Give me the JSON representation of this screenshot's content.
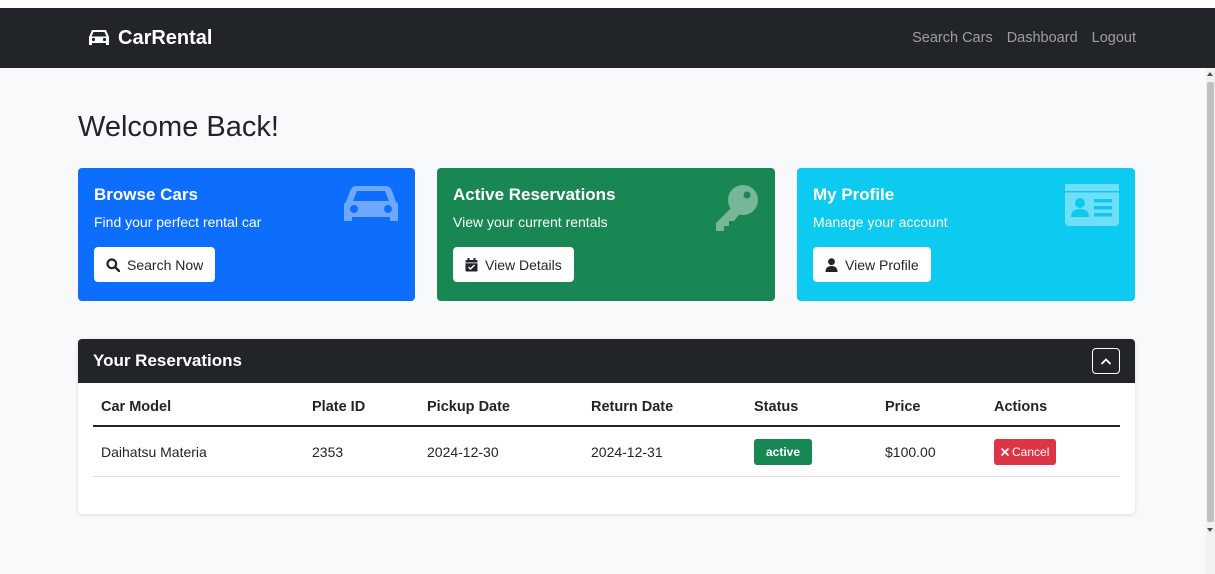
{
  "navbar": {
    "brand": "CarRental",
    "links": [
      "Search Cars",
      "Dashboard",
      "Logout"
    ]
  },
  "page": {
    "title": "Welcome Back!"
  },
  "cards": [
    {
      "title": "Browse Cars",
      "subtitle": "Find your perfect rental car",
      "button": "Search Now",
      "icon": "car-icon",
      "button_icon": "search-icon",
      "color": "#0d6efd"
    },
    {
      "title": "Active Reservations",
      "subtitle": "View your current rentals",
      "button": "View Details",
      "icon": "key-icon",
      "button_icon": "calendar-check-icon",
      "color": "#198754"
    },
    {
      "title": "My Profile",
      "subtitle": "Manage your account",
      "button": "View Profile",
      "icon": "id-card-icon",
      "button_icon": "user-icon",
      "color": "#0dcaf0"
    }
  ],
  "reservations": {
    "title": "Your Reservations",
    "columns": [
      "Car Model",
      "Plate ID",
      "Pickup Date",
      "Return Date",
      "Status",
      "Price",
      "Actions"
    ],
    "rows": [
      {
        "car_model": "Daihatsu Materia",
        "plate_id": "2353",
        "pickup_date": "2024-12-30",
        "return_date": "2024-12-31",
        "status": "active",
        "price": "$100.00",
        "action": "Cancel"
      }
    ]
  },
  "colors": {
    "dark": "#212529",
    "danger": "#dc3545",
    "success": "#198754"
  }
}
